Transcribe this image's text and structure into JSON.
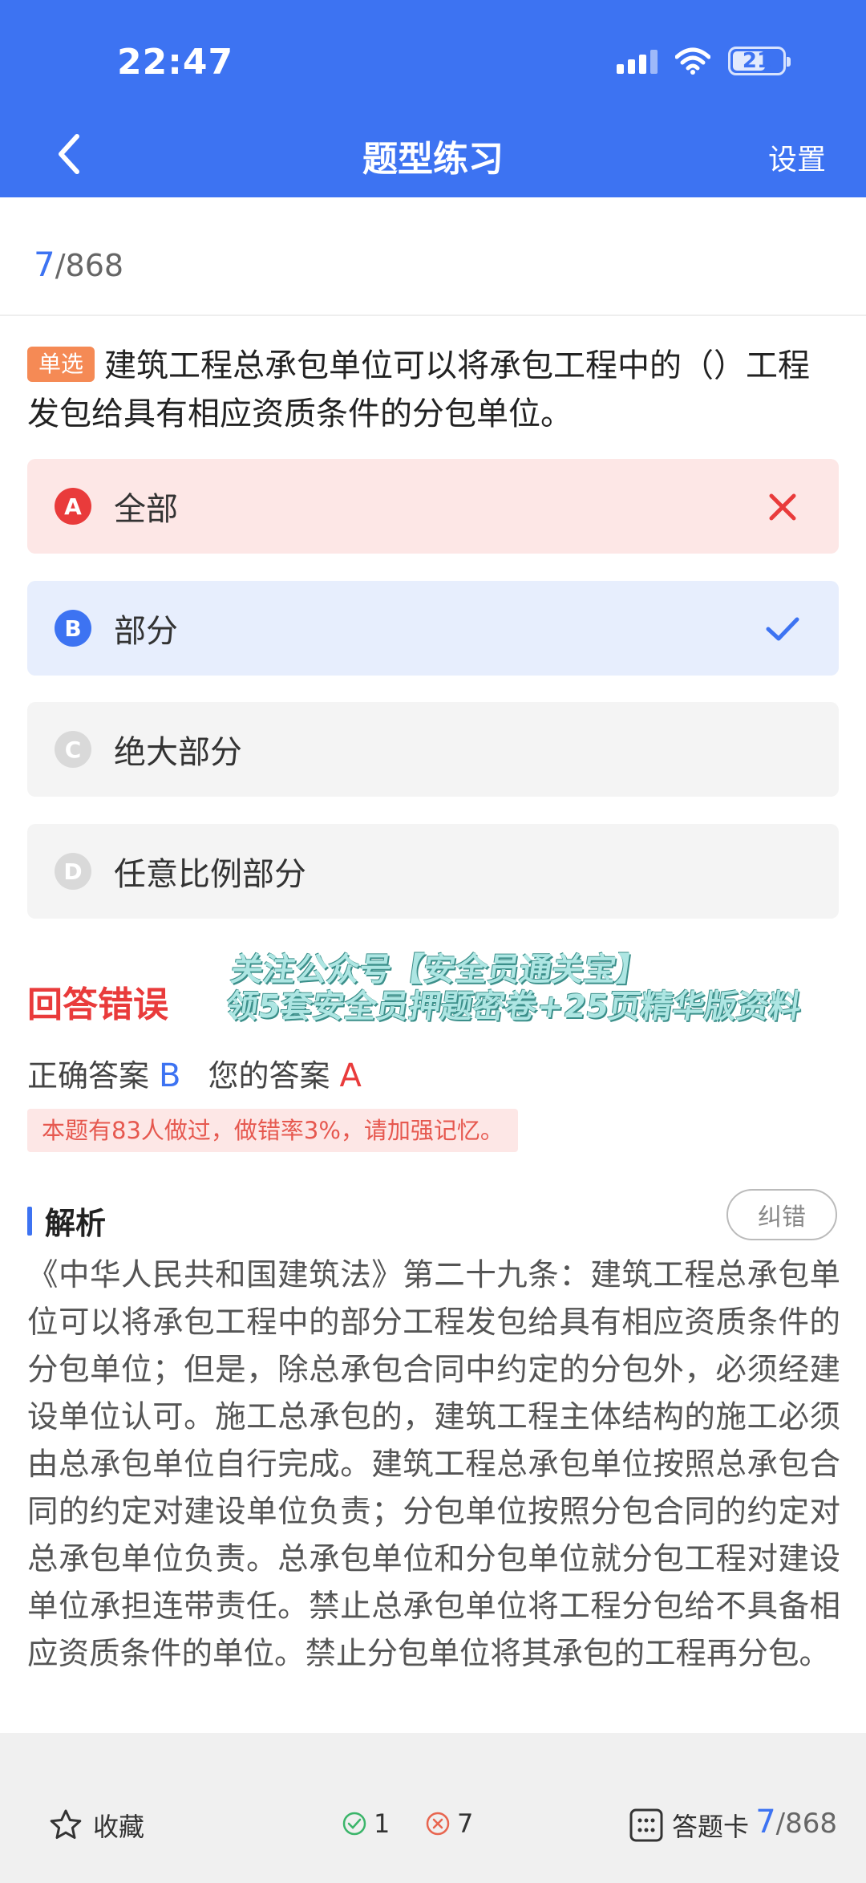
{
  "status_bar": {
    "time": "22:47",
    "battery": "21"
  },
  "nav": {
    "title": "题型练习",
    "settings": "设置"
  },
  "progress": {
    "current": "7",
    "total": "/868"
  },
  "question": {
    "type": "单选",
    "text": "建筑工程总承包单位可以将承包工程中的（）工程发包给具有相应资质条件的分包单位。"
  },
  "options": [
    {
      "letter": "A",
      "text": "全部",
      "state": "wrong"
    },
    {
      "letter": "B",
      "text": "部分",
      "state": "correct"
    },
    {
      "letter": "C",
      "text": "绝大部分",
      "state": "none"
    },
    {
      "letter": "D",
      "text": "任意比例部分",
      "state": "none"
    }
  ],
  "result": {
    "title": "回答错误",
    "correct_label": "正确答案",
    "correct_value": "B",
    "your_label": "您的答案",
    "your_value": "A",
    "stat_note": "本题有83人做过，做错率3%，请加强记忆。"
  },
  "watermark": {
    "line1": "关注公众号【安全员通关宝】",
    "line2": "领5套安全员押题密卷+25页精华版资料"
  },
  "analysis": {
    "label": "解析",
    "report": "纠错",
    "text": "《中华人民共和国建筑法》第二十九条：建筑工程总承包单位可以将承包工程中的部分工程发包给具有相应资质条件的分包单位；但是，除总承包合同中约定的分包外，必须经建设单位认可。施工总承包的，建筑工程主体结构的施工必须由总承包单位自行完成。建筑工程总承包单位按照总承包合同的约定对建设单位负责；分包单位按照分包合同的约定对总承包单位负责。总承包单位和分包单位就分包工程对建设单位承担连带责任。禁止总承包单位将工程分包给不具备相应资质条件的单位。禁止分包单位将其承包的工程再分包。"
  },
  "bottom_bar": {
    "favorite": "收藏",
    "right_count": "1",
    "wrong_count": "7",
    "answer_card": "答题卡",
    "current": "7",
    "total": "/868"
  },
  "colors": {
    "primary": "#3d73f2",
    "error": "#e93b3b",
    "question_tag": "#f58a55",
    "right_icon": "#3bb56a",
    "wrong_icon": "#e8654f"
  },
  "icons": {
    "back": "chevron-left-icon",
    "wrong_mark": "close-icon",
    "right_mark": "check-icon",
    "favorite": "star-icon",
    "right_count": "check-circle-icon",
    "wrong_count": "x-circle-icon",
    "answer_card": "grid-icon"
  }
}
